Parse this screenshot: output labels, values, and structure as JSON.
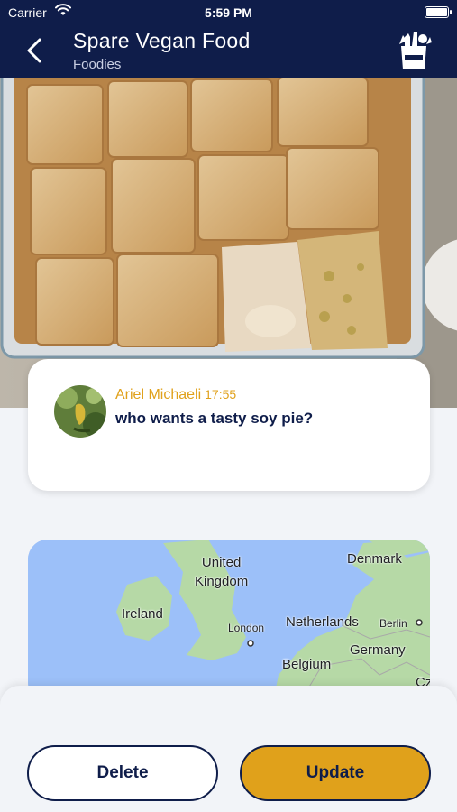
{
  "status_bar": {
    "carrier": "Carrier",
    "time": "5:59 PM",
    "battery_level": 1.0
  },
  "nav": {
    "title": "Spare Vegan Food",
    "subtitle": "Foodies",
    "back_icon": "chevron-left-icon",
    "category_icon": "groceries-bag-icon"
  },
  "hero_image": {
    "subject": "soy-pie-photo"
  },
  "message": {
    "author": "Ariel Michaeli",
    "time": "17:55",
    "text": "who wants a tasty soy pie?"
  },
  "map": {
    "labels": {
      "united_kingdom": "United Kingdom",
      "ireland": "Ireland",
      "london": "London",
      "denmark": "Denmark",
      "netherlands": "Netherlands",
      "berlin": "Berlin",
      "germany": "Germany",
      "belgium": "Belgium",
      "cz_fragment": "Cz"
    }
  },
  "actions": {
    "delete_label": "Delete",
    "update_label": "Update"
  },
  "colors": {
    "navy": "#0f1d4a",
    "accent": "#e0a11b",
    "background": "#f2f4f8"
  }
}
